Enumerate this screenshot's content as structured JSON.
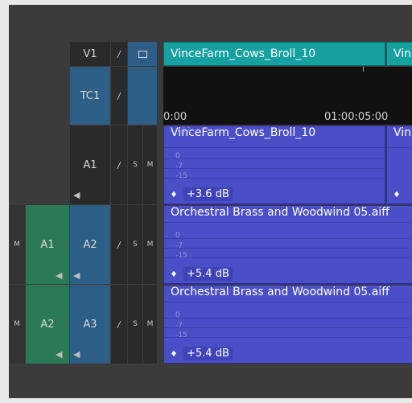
{
  "tracks": {
    "video": {
      "name": "V1"
    },
    "timecode": {
      "name": "TC1"
    },
    "audio": [
      {
        "source": "",
        "name": "A1",
        "solo": "S",
        "mute": "M"
      },
      {
        "source": "A1",
        "name": "A2",
        "solo": "S",
        "mute": "M",
        "src_mute": "M"
      },
      {
        "source": "A2",
        "name": "A3",
        "solo": "S",
        "mute": "M",
        "src_mute": "M"
      }
    ]
  },
  "ruler": {
    "start": "0:00",
    "mark": "01:00:05:00"
  },
  "clips": {
    "video_main": "VinceFarm_Cows_Broll_10",
    "video_next": "Vin",
    "a1_main": "VinceFarm_Cows_Broll_10",
    "a1_next": "Vin",
    "a2": "Orchestral Brass and Woodwind 05.aiff",
    "a3": "Orchestral Brass and Woodwind 05.aiff"
  },
  "gains": {
    "a1": "+3.6 dB",
    "a2": "+5.4 dB",
    "a3": "+5.4 dB"
  },
  "db_scale": [
    "+12",
    "0",
    "-7",
    "-15"
  ],
  "icons": {
    "lock": "pencil-icon",
    "speaker": "speaker-icon",
    "display": "monitor-icon",
    "keyframe": "keyframe-icon"
  }
}
